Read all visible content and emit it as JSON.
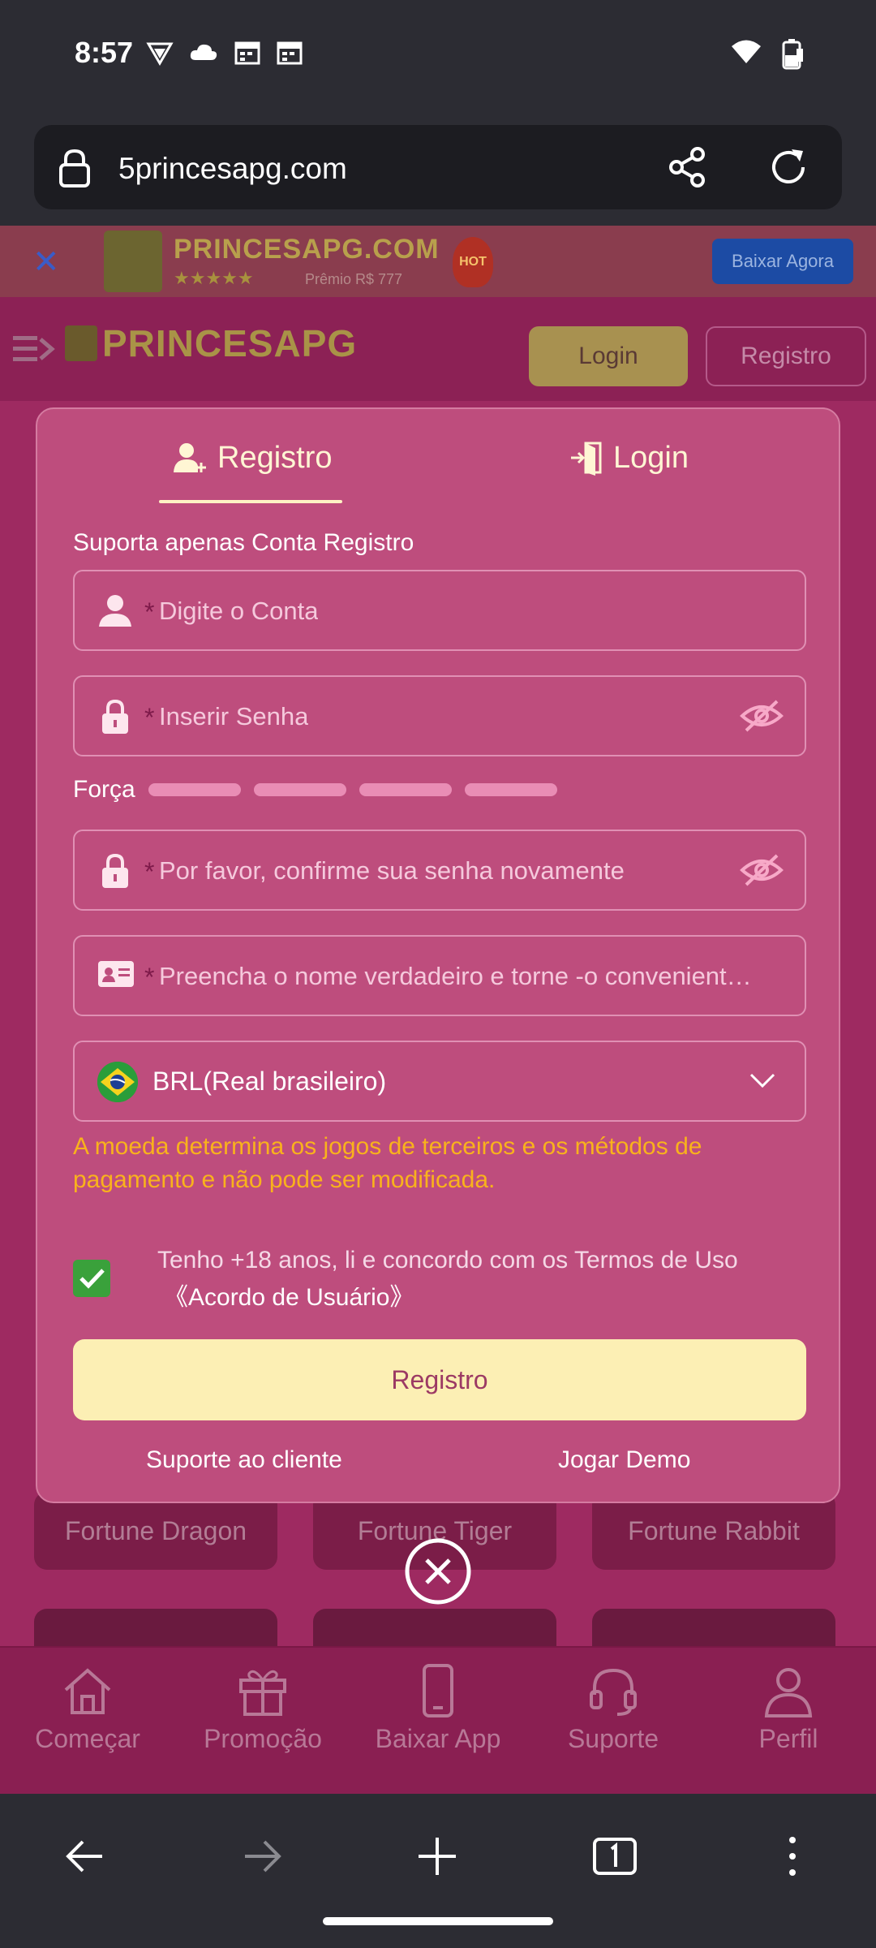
{
  "status_bar": {
    "time": "8:57"
  },
  "browser": {
    "url": "5princesapg.com"
  },
  "banner": {
    "brand": "PRINCESAPG.COM",
    "stars": "★★★★★",
    "subtitle": "Prêmio R$ 777",
    "hot": "HOT",
    "download_label": "Baixar Agora"
  },
  "header": {
    "logo_text": "PRINCESAPG",
    "login_label": "Login",
    "register_label": "Registro"
  },
  "games": [
    "Fortune Dragon",
    "Fortune Tiger",
    "Fortune Rabbit"
  ],
  "bottom_nav": [
    "Começar",
    "Promoção",
    "Baixar App",
    "Suporte",
    "Perfil"
  ],
  "modal": {
    "tab_register": "Registro",
    "tab_login": "Login",
    "subtitle": "Suporta apenas Conta Registro",
    "required_mark": "*",
    "account_placeholder": "Digite o Conta",
    "password_placeholder": "Inserir Senha",
    "strength_label": "Força",
    "confirm_placeholder": "Por favor, confirme sua senha novamente",
    "realname_placeholder": "Preencha o nome verdadeiro e torne -o conveniente para a retirada posterior",
    "currency": "BRL(Real brasileiro)",
    "currency_warning": "A moeda determina os jogos de terceiros e os métodos de pagamento e não pode ser modificada.",
    "agree_text": "Tenho +18 anos, li e concordo com os Termos de Uso",
    "agree_link": "《Acordo de Usuário》",
    "agree_checked": true,
    "submit_label": "Registro",
    "support_link": "Suporte ao cliente",
    "demo_link": "Jogar Demo"
  },
  "colors": {
    "modal_bg": "#be4d7d",
    "accent_yellow": "#fcefb4",
    "warning": "#f9b21c",
    "checkbox": "#3aa13b"
  }
}
